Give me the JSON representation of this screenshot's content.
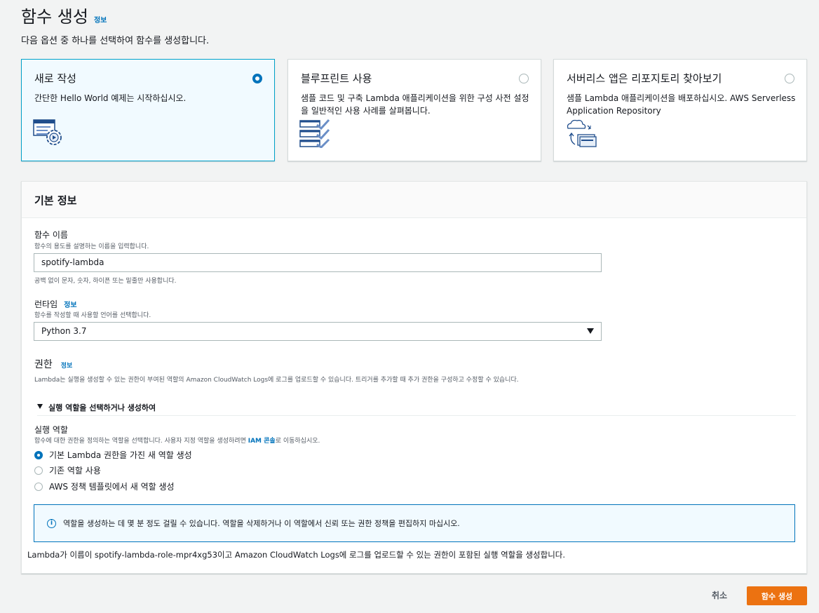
{
  "page": {
    "title": "함수 생성",
    "info_link": "정보",
    "description": "다음 옵션 중 하나를 선택하여 함수를 생성합니다."
  },
  "options": [
    {
      "title": "새로 작성",
      "desc": "간단한 Hello World 예제는 시작하십시오.",
      "selected": true,
      "icon": "author-from-scratch-icon"
    },
    {
      "title": "블루프린트 사용",
      "desc": "샘플 코드 및 구축 Lambda 애플리케이션을 위한 구성 사전 설정을 일반적인 사용 사례를 살펴봅니다.",
      "selected": false,
      "icon": "blueprint-icon"
    },
    {
      "title": "서버리스 앱은 리포지토리 찾아보기",
      "desc": "샘플 Lambda 애플리케이션을 배포하십시오. AWS Serverless Application Repository",
      "selected": false,
      "icon": "serverless-repo-icon"
    }
  ],
  "basic_info": {
    "header": "기본 정보",
    "function_name": {
      "label": "함수 이름",
      "description": "함수의 용도를 설명하는 이름을 입력합니다.",
      "value": "spotify-lambda",
      "constraint": "공백 없이 문자, 숫자, 하이픈 또는 밑줄만 사용합니다."
    },
    "runtime": {
      "label": "런타임",
      "info_link": "정보",
      "description": "함수를 작성할 때 사용할 언어를 선택합니다.",
      "value": "Python 3.7"
    },
    "permissions": {
      "title": "권한",
      "info_link": "정보",
      "description": "Lambda는 실행을 생성할 수 있는 권한이 부여된 역할의 Amazon CloudWatch Logs에 로그를 업로드할 수 있습니다. 트리거를 추가할 때 추가 권한을 구성하고 수정할 수 있습니다.",
      "expander": "실행 역할을 선택하거나 생성하여",
      "exec_role_label": "실행 역할",
      "exec_role_desc_prefix": "함수에 대한 권한을 정의하는 역할을 선택합니다. 사용자 지정 역할을 생성하려면 ",
      "exec_role_desc_link": "IAM 콘솔",
      "exec_role_desc_suffix": "로 이동하십시오.",
      "role_options": [
        {
          "label": "기본 Lambda 권한을 가진 새 역할 생성",
          "checked": true
        },
        {
          "label": "기존 역할 사용",
          "checked": false
        },
        {
          "label": "AWS 정책 템플릿에서 새 역할 생성",
          "checked": false
        }
      ],
      "alert": "역할을 생성하는 데 몇 분 정도 걸릴 수 있습니다. 역할을 삭제하거나 이 역할에서 신뢰 또는 권한 정책을 편집하지 마십시오.",
      "footer": "Lambda가 이름이 spotify-lambda-role-mpr4xg53이고 Amazon CloudWatch Logs에 로그를 업로드할 수 있는 권한이 포함된 실행 역할을 생성합니다."
    }
  },
  "actions": {
    "cancel": "취소",
    "create": "함수 생성"
  },
  "colors": {
    "primary": "#ec7211",
    "link": "#0073bb",
    "selected_bg": "#f1faff"
  }
}
